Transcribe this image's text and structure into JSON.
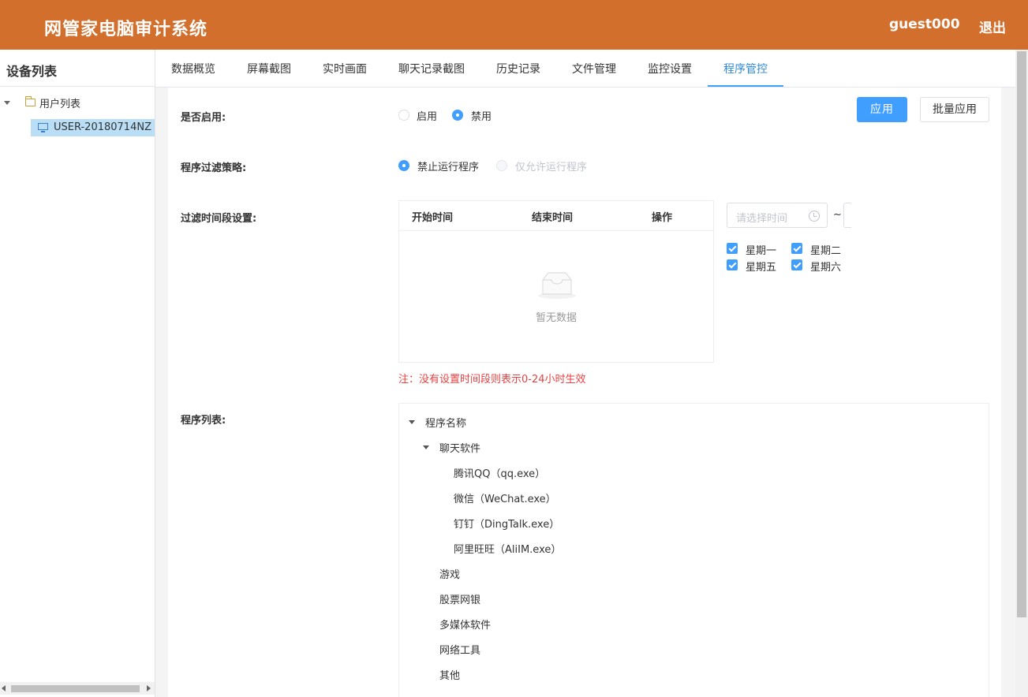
{
  "header": {
    "title": "网管家电脑审计系统",
    "user": "guest000",
    "logout": "退出",
    "color": "#d26f2c"
  },
  "sidebar": {
    "title": "设备列表",
    "tree_root": "用户列表",
    "device": "USER-20180714NZ"
  },
  "tabs": [
    {
      "label": "数据概览"
    },
    {
      "label": "屏幕截图"
    },
    {
      "label": "实时画面"
    },
    {
      "label": "聊天记录截图"
    },
    {
      "label": "历史记录"
    },
    {
      "label": "文件管理"
    },
    {
      "label": "监控设置"
    },
    {
      "label": "程序管控",
      "active": true
    }
  ],
  "form": {
    "enable_label": "是否启用:",
    "enable_options": [
      "启用",
      "禁用"
    ],
    "enable_selected": "禁用",
    "apply_button": "应用",
    "batch_apply_button": "批量应用",
    "strategy_label": "程序过滤策略:",
    "strategy_options": [
      "禁止运行程序",
      "仅允许运行程序"
    ],
    "strategy_selected": "禁止运行程序",
    "time_label": "过滤时间段设置:",
    "time_table": {
      "columns": [
        "开始时间",
        "结束时间",
        "操作"
      ],
      "empty_text": "暂无数据"
    },
    "time_placeholder": "请选择时间",
    "range_separator": "~",
    "weekdays": [
      {
        "label": "星期一",
        "checked": true
      },
      {
        "label": "星期二",
        "checked": true
      },
      {
        "label": "星期五",
        "checked": true
      },
      {
        "label": "星期六",
        "checked": true
      }
    ],
    "note": "注：没有设置时间段则表示0-24小时生效",
    "program_list_label": "程序列表:",
    "program_tree": {
      "root": "程序名称",
      "categories": [
        {
          "label": "聊天软件",
          "expanded": true,
          "children": [
            "腾讯QQ（qq.exe）",
            "微信（WeChat.exe）",
            "钉钉（DingTalk.exe）",
            "阿里旺旺（AliIM.exe）"
          ]
        },
        {
          "label": "游戏"
        },
        {
          "label": "股票网银"
        },
        {
          "label": "多媒体软件"
        },
        {
          "label": "网络工具"
        },
        {
          "label": "其他"
        }
      ]
    }
  },
  "accent_color": "#409eff"
}
